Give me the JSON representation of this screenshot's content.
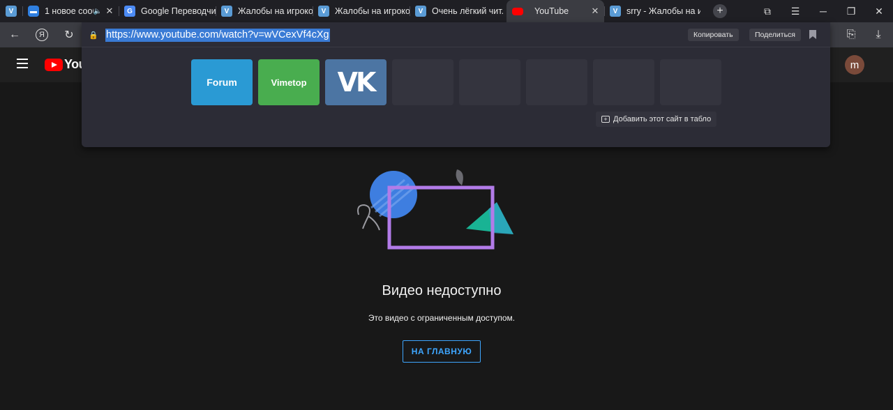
{
  "tabs": [
    {
      "icon": "vk-icon",
      "title": "",
      "kind": "vk"
    },
    {
      "icon": "message-icon",
      "title": "1 новое сооб",
      "kind": "msg",
      "sound": "🔈"
    },
    {
      "icon": "google-translate-icon",
      "title": "Google Переводчи",
      "kind": "gt"
    },
    {
      "icon": "vk-icon",
      "title": "Жалобы на игроко",
      "kind": "vk"
    },
    {
      "icon": "vk-icon",
      "title": "Жалобы на игроко",
      "kind": "vk"
    },
    {
      "icon": "vk-icon",
      "title": "Очень лёгкий чит.",
      "kind": "vk"
    },
    {
      "icon": "youtube-icon",
      "title": "YouTube",
      "kind": "yt",
      "active": true
    },
    {
      "icon": "vk-icon",
      "title": "srry - Жалобы на и",
      "kind": "vk"
    }
  ],
  "omnibox": {
    "url": "https://www.youtube.com/watch?v=wVCexVf4cXg",
    "copy_label": "Копировать",
    "share_label": "Поделиться",
    "add_site_label": "Добавить этот сайт в табло",
    "tiles": [
      {
        "label": "Forum",
        "kind": "forum"
      },
      {
        "label": "Vimetop",
        "kind": "vimetop"
      },
      {
        "label": "VK",
        "kind": "vk"
      },
      {
        "label": "",
        "kind": "empty"
      },
      {
        "label": "",
        "kind": "empty"
      },
      {
        "label": "",
        "kind": "empty"
      },
      {
        "label": "",
        "kind": "empty"
      },
      {
        "label": "",
        "kind": "empty"
      }
    ]
  },
  "youtube": {
    "logo_text": "YouTube",
    "avatar_letter": "m",
    "title": "Видео недоступно",
    "subtitle": "Это видео с ограниченным доступом.",
    "home_button": "НА ГЛАВНУЮ"
  },
  "colors": {
    "accent_blue": "#3ea6ff",
    "url_highlight": "#3a7bd5",
    "youtube_red": "#ff0000",
    "forum_tile": "#2a9ad4",
    "vimetop_tile": "#49ad4f",
    "vk_tile": "#4c75a3"
  }
}
